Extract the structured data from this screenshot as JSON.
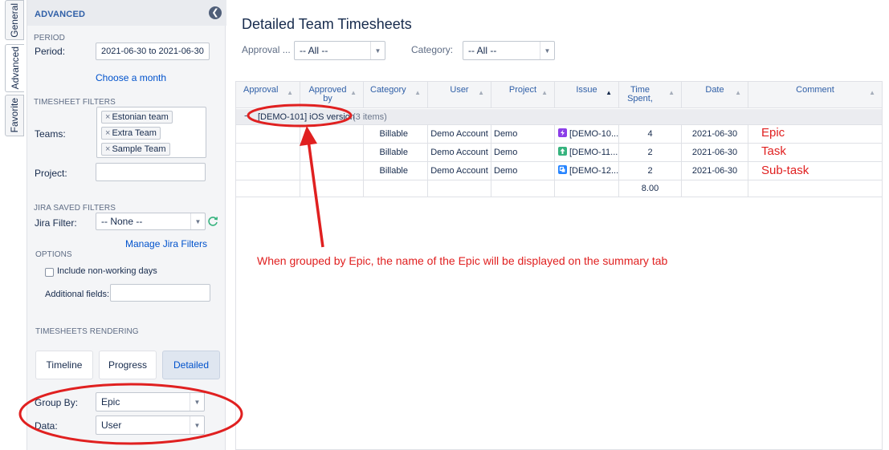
{
  "vertical_tabs": [
    {
      "label": "General"
    },
    {
      "label": "Advanced"
    },
    {
      "label": "Favorite"
    }
  ],
  "sidebar": {
    "header": "ADVANCED",
    "period": {
      "section": "PERIOD",
      "label": "Period:",
      "value": "2021-06-30 to 2021-06-30",
      "choose_link": "Choose a month"
    },
    "filters": {
      "section": "TIMESHEET FILTERS",
      "teams_label": "Teams:",
      "teams": [
        "Estonian team",
        "Extra Team",
        "Sample Team"
      ],
      "project_label": "Project:",
      "project_value": ""
    },
    "jira": {
      "section": "JIRA SAVED FILTERS",
      "filter_label": "Jira Filter:",
      "filter_value": "-- None --",
      "manage_link": "Manage Jira Filters"
    },
    "options": {
      "section": "OPTIONS",
      "nonworking_label": "Include non-working days",
      "nonworking_checked": false,
      "additional_label": "Additional fields:",
      "additional_value": ""
    },
    "rendering": {
      "section": "TIMESHEETS RENDERING",
      "buttons": [
        "Timeline",
        "Progress",
        "Detailed"
      ],
      "selected": "Detailed"
    },
    "group_by": {
      "label": "Group By:",
      "value": "Epic"
    },
    "data": {
      "label": "Data:",
      "value": "User"
    }
  },
  "main": {
    "title": "Detailed Team Timesheets",
    "filters": {
      "approval_label": "Approval ...",
      "approval_value": "-- All --",
      "category_label": "Category:",
      "category_value": "-- All --"
    },
    "columns": [
      "Approval",
      "Approved by",
      "Category",
      "User",
      "Project",
      "Issue",
      "Time Spent,",
      "Date",
      "Comment"
    ],
    "group": {
      "toggle": "−",
      "name": "[DEMO-101] iOS version",
      "count": "(3 items)"
    },
    "rows": [
      {
        "approval": "",
        "approved_by": "",
        "category": "Billable",
        "user": "Demo Account",
        "project": "Demo",
        "issue_type": "epic",
        "issue": "[DEMO-10...",
        "time": "4",
        "date": "2021-06-30",
        "comment": "",
        "annotation": "Epic"
      },
      {
        "approval": "",
        "approved_by": "",
        "category": "Billable",
        "user": "Demo Account",
        "project": "Demo",
        "issue_type": "task",
        "issue": "[DEMO-11...",
        "time": "2",
        "date": "2021-06-30",
        "comment": "",
        "annotation": "Task"
      },
      {
        "approval": "",
        "approved_by": "",
        "category": "Billable",
        "user": "Demo Account",
        "project": "Demo",
        "issue_type": "subtask",
        "issue": "[DEMO-12...",
        "time": "2",
        "date": "2021-06-30",
        "comment": "",
        "annotation": "Sub-task"
      }
    ],
    "total_time": "8.00"
  },
  "annotation": {
    "note": "When grouped by Epic, the name of the Epic will be displayed on the summary tab",
    "color": "#e02020"
  },
  "colors": {
    "link": "#0052cc",
    "header_text": "#2f5fa7",
    "epic": "#8b3ee8",
    "task": "#36b37e",
    "subtask": "#2684ff"
  }
}
